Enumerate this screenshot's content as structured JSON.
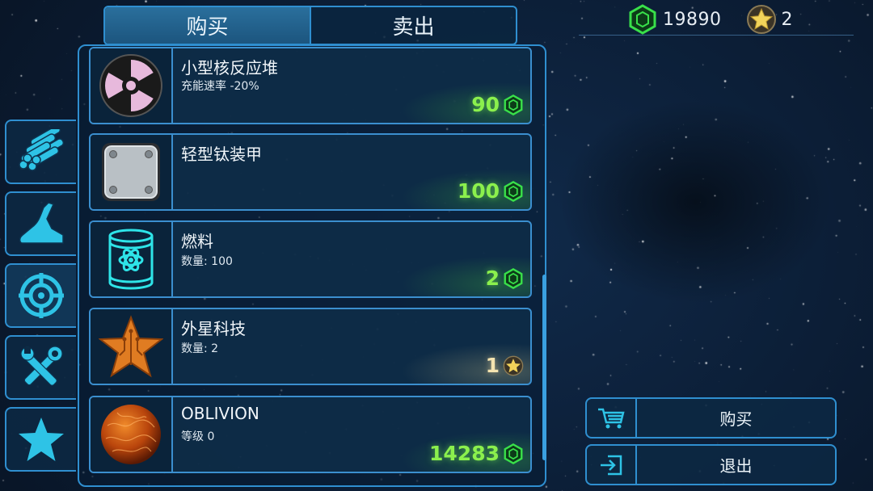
{
  "tabs": [
    {
      "label": "购买",
      "active": true
    },
    {
      "label": "卖出",
      "active": false
    }
  ],
  "currency": {
    "credits": "19890",
    "stars": "2",
    "credit_icon": "green-cube-icon",
    "star_icon": "gold-star-icon"
  },
  "categories": [
    {
      "icon": "pipes-icon"
    },
    {
      "icon": "hull-ship-icon"
    },
    {
      "icon": "crosshair-icon"
    },
    {
      "icon": "tools-icon"
    },
    {
      "icon": "star-icon"
    }
  ],
  "items": [
    {
      "name": "小型核反应堆",
      "desc": "充能速率 -20%",
      "price": "90",
      "currency": "cube",
      "icon": "radiation-icon"
    },
    {
      "name": "轻型钛装甲",
      "desc": "",
      "price": "100",
      "currency": "cube",
      "icon": "armor-plate-icon"
    },
    {
      "name": "燃料",
      "desc": "数量: 100",
      "price": "2",
      "currency": "cube",
      "icon": "fuel-barrel-icon"
    },
    {
      "name": "外星科技",
      "desc": "数量: 2",
      "price": "1",
      "currency": "star",
      "icon": "alien-tech-star-icon"
    },
    {
      "name": "OBLIVION",
      "desc": "等级 0",
      "price": "14283",
      "currency": "cube",
      "icon": "oblivion-sphere-icon"
    }
  ],
  "actions": {
    "buy_label": "购买",
    "exit_label": "退出"
  },
  "colors": {
    "accent": "#2f8fd0",
    "price_green": "#8bf04d",
    "background": "#0b1c33"
  }
}
